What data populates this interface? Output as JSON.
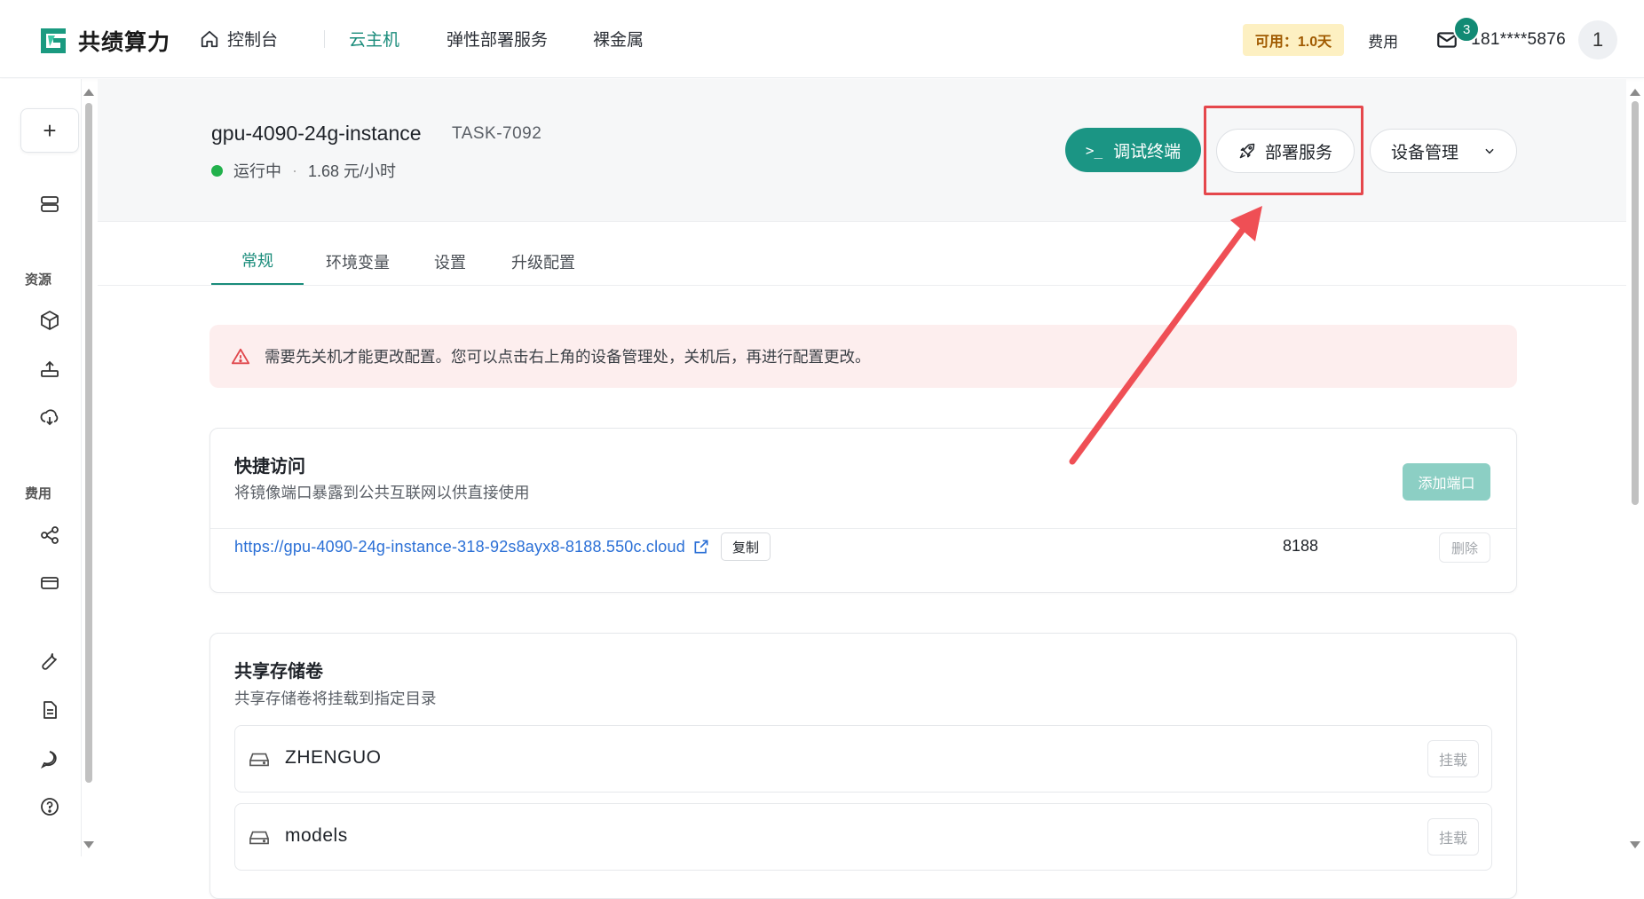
{
  "brand": {
    "name": "共绩算力",
    "accent": "#1a8c7b"
  },
  "nav": {
    "home": "控制台",
    "cloud_host": "云主机",
    "elastic": "弹性部署服务",
    "bare_metal": "裸金属"
  },
  "topbar": {
    "balance": "可用：1.0天",
    "fee": "费用",
    "mail_count": "3",
    "phone": "181****5876",
    "avatar": "1"
  },
  "sidebar": {
    "add": "+",
    "section_resources": "资源",
    "section_fees": "费用"
  },
  "instance": {
    "name": "gpu-4090-24g-instance",
    "task_id": "TASK-7092",
    "status": "运行中",
    "separator": "·",
    "price": "1.68 元/小时",
    "status_color": "#22b14c"
  },
  "actions": {
    "terminal": "调试终端",
    "deploy": "部署服务",
    "device": "设备管理"
  },
  "tabs": [
    "常规",
    "环境变量",
    "设置",
    "升级配置"
  ],
  "alert": {
    "text": "需要先关机才能更改配置。您可以点击右上角的设备管理处，关机后，再进行配置更改。"
  },
  "quick_access": {
    "title": "快捷访问",
    "subtitle": "将镜像端口暴露到公共互联网以供直接使用",
    "add_port": "添加端口",
    "url": "https://gpu-4090-24g-instance-318-92s8ayx8-8188.550c.cloud",
    "copy": "复制",
    "port": "8188",
    "delete": "删除"
  },
  "shared_storage": {
    "title": "共享存储卷",
    "subtitle": "共享存储卷将挂载到指定目录",
    "volumes": [
      {
        "name": "ZHENGUO",
        "action": "挂载"
      },
      {
        "name": "models",
        "action": "挂载"
      }
    ]
  }
}
